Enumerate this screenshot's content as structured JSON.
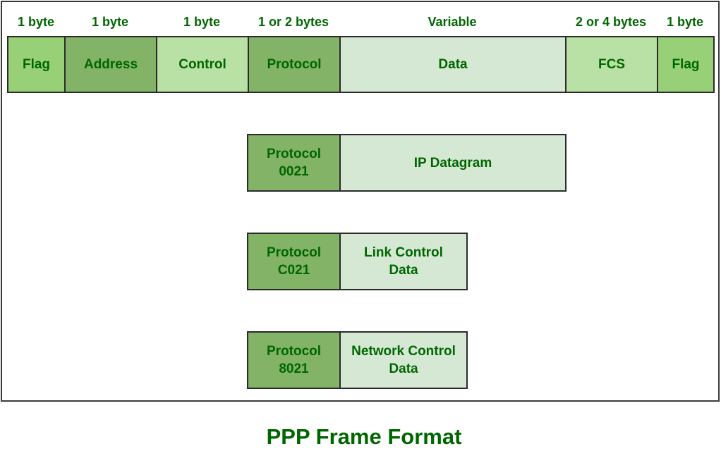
{
  "title": "PPP Frame Format",
  "frame": {
    "fields": [
      {
        "name": "Flag",
        "size": "1 byte"
      },
      {
        "name": "Address",
        "size": "1 byte"
      },
      {
        "name": "Control",
        "size": "1 byte"
      },
      {
        "name": "Protocol",
        "size": "1 or 2 bytes"
      },
      {
        "name": "Data",
        "size": "Variable"
      },
      {
        "name": "FCS",
        "size": "2 or 4 bytes"
      },
      {
        "name": "Flag",
        "size": "1 byte"
      }
    ]
  },
  "protocol_examples": [
    {
      "protocol": "Protocol\n0021",
      "payload": "IP Datagram"
    },
    {
      "protocol": "Protocol\nC021",
      "payload": "Link Control\nData"
    },
    {
      "protocol": "Protocol\n8021",
      "payload": "Network Control\nData"
    }
  ],
  "colors": {
    "text": "#006600",
    "flag": "#97d077",
    "address_protocol": "#82b366",
    "control_fcs": "#b9e0a5",
    "data": "#d5e8d4",
    "border": "#2b2b2b"
  }
}
